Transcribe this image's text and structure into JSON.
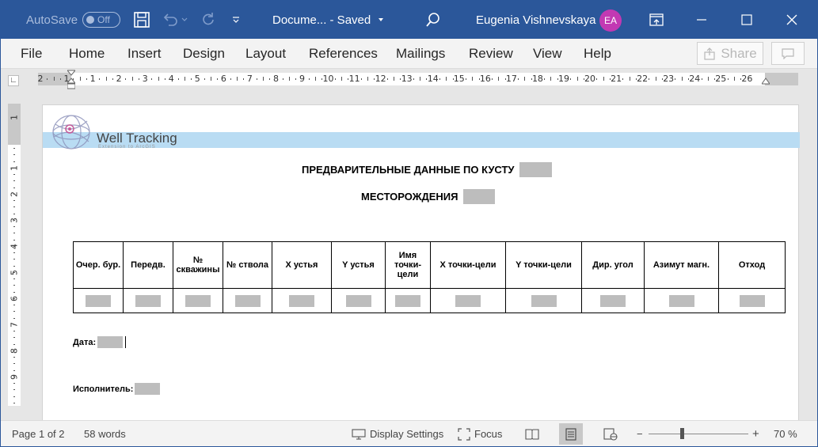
{
  "titlebar": {
    "autosave_label": "AutoSave",
    "autosave_state": "Off",
    "doc_title": "Docume...  -  Saved",
    "user_name": "Eugenia Vishnevskaya",
    "user_initials": "EA",
    "accent_color": "#2b579a",
    "avatar_color": "#c239b3"
  },
  "ribbon": {
    "tabs": [
      "File",
      "Home",
      "Insert",
      "Design",
      "Layout",
      "References",
      "Mailings",
      "Review",
      "View",
      "Help"
    ],
    "share_label": "Share"
  },
  "ruler": {
    "h_ticks": [
      "2",
      "1",
      "1",
      "2",
      "3",
      "4",
      "5",
      "6",
      "7",
      "8",
      "9",
      "10",
      "11",
      "12",
      "13",
      "14",
      "15",
      "16",
      "17",
      "18",
      "19",
      "20",
      "21",
      "22",
      "23",
      "24",
      "25",
      "26"
    ],
    "v_ticks": [
      "1",
      "1",
      "2",
      "3",
      "4",
      "5",
      "6",
      "7",
      "8",
      "9"
    ]
  },
  "document": {
    "logo_text": "Well Tracking",
    "logo_subtext": "Extension to ArcGIS",
    "heading1": "ПРЕДВАРИТЕЛЬНЫЕ ДАННЫЕ ПО КУСТУ",
    "heading2": "МЕСТОРОЖДЕНИЯ",
    "table_headers": [
      "Очер. бур.",
      "Передв.",
      "№ скважины",
      "№ ствола",
      "X устья",
      "Y устья",
      "Имя точки-цели",
      "X точки-цели",
      "Y точки-цели",
      "Дир. угол",
      "Азимут магн.",
      "Отход"
    ],
    "date_label": "Дата:",
    "executor_label": "Исполнитель:"
  },
  "statusbar": {
    "page": "Page 1 of 2",
    "words": "58 words",
    "display_settings": "Display Settings",
    "focus": "Focus",
    "zoom_minus": "−",
    "zoom_plus": "+",
    "zoom": "70 %"
  }
}
